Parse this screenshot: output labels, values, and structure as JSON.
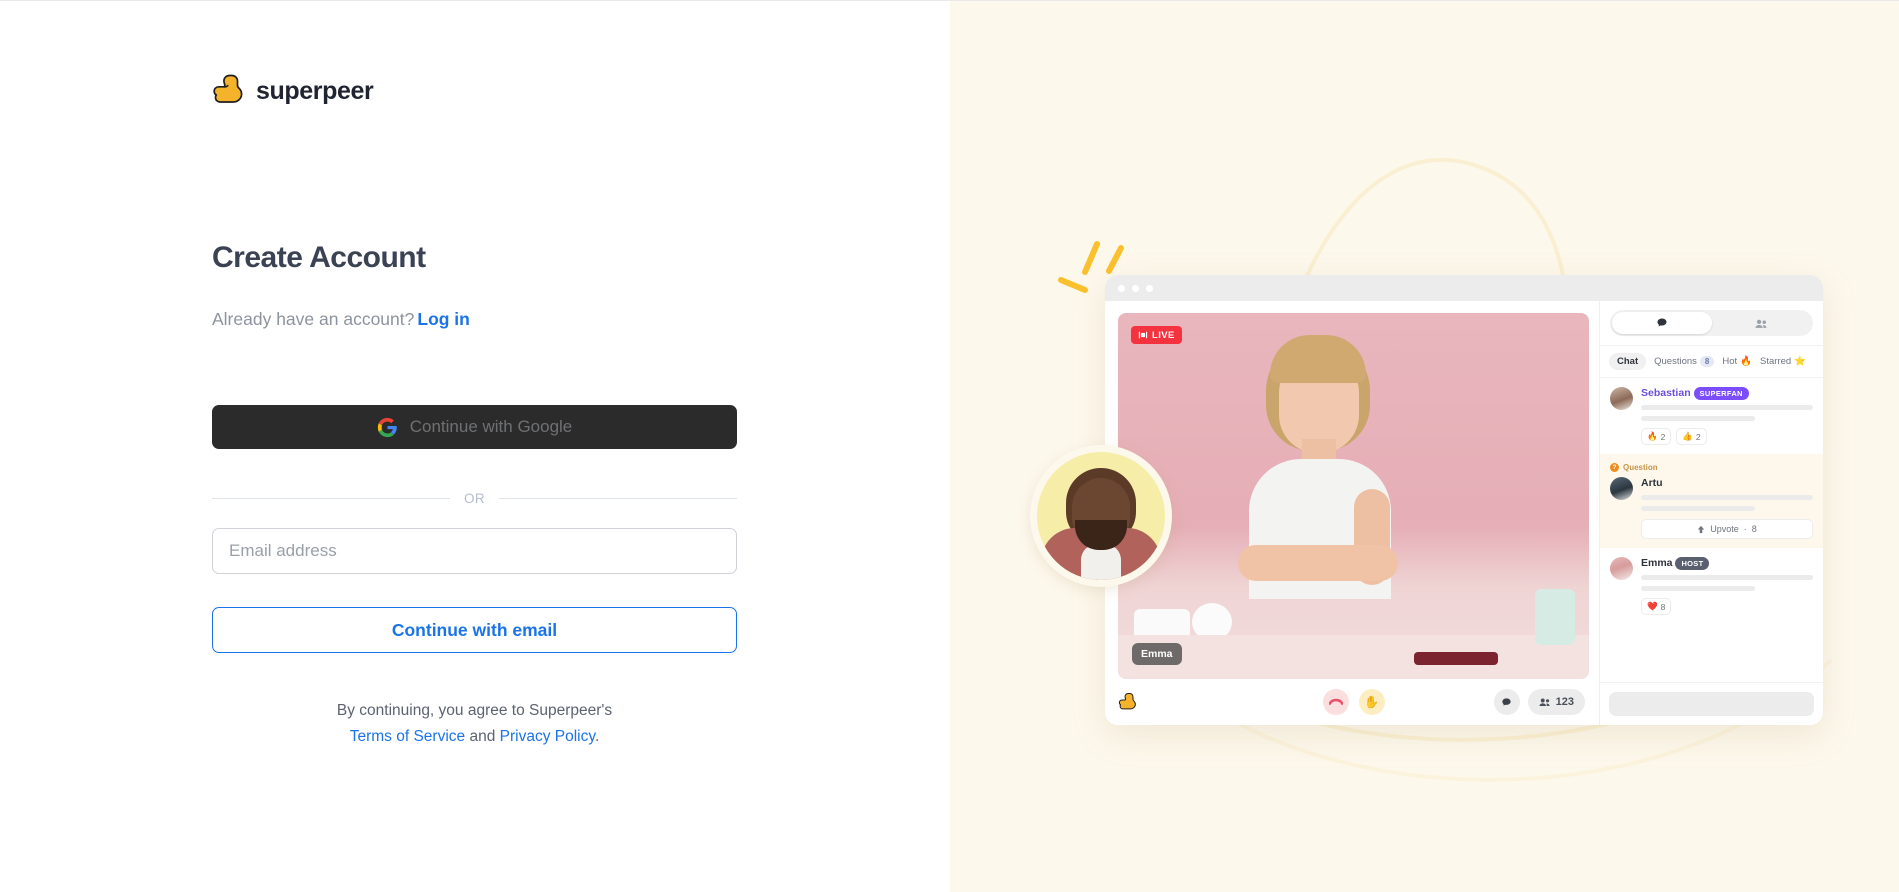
{
  "brand": {
    "name": "superpeer",
    "logo_icon": "thumbs-up-logo",
    "logo_color": "#F5B32B"
  },
  "auth": {
    "headline": "Create Account",
    "existing_account_text": "Already have an account?",
    "login_link": "Log in",
    "google_button": {
      "label": "Continue with Google",
      "icon": "google-g-icon",
      "bg": "#2B2B2B"
    },
    "divider_label": "OR",
    "email_input": {
      "placeholder": "Email address",
      "value": ""
    },
    "email_button": {
      "label": "Continue with email",
      "accent": "#1A73E8"
    },
    "legal": {
      "line1": "By continuing, you agree to Superpeer's",
      "terms_link": "Terms of Service",
      "and_text": "and",
      "privacy_link": "Privacy Policy",
      "period": "."
    }
  },
  "hero": {
    "background": "#FDF8EC",
    "live_badge": "LIVE",
    "speaker_name": "Emma",
    "toolbar": {
      "logo_icon": "superpeer-mark-icon",
      "hangup_icon": "hangup-icon",
      "raise_hand_icon": "raise-hand-icon",
      "chat_icon": "chat-bubble-icon",
      "participants_icon": "people-icon",
      "participants_count": "123"
    },
    "chat_panel": {
      "toggle": {
        "chat_icon": "chat-bubble-icon",
        "people_icon": "people-icon"
      },
      "tabs": [
        {
          "label": "Chat",
          "active": true
        },
        {
          "label": "Questions",
          "badge": "8",
          "active": false
        },
        {
          "label": "Hot",
          "emoji": "🔥",
          "active": false
        },
        {
          "label": "Starred",
          "emoji": "⭐",
          "active": false
        }
      ],
      "messages": [
        {
          "name": "Sebastian",
          "badge": "SUPERFAN",
          "badge_type": "superfan",
          "reactions": [
            {
              "emoji": "🔥",
              "count": "2"
            },
            {
              "emoji": "👍",
              "count": "2"
            }
          ]
        },
        {
          "name": "Artu",
          "question_label": "Question",
          "upvote_label": "Upvote",
          "upvote_separator": "·",
          "upvote_count": "8"
        },
        {
          "name": "Emma",
          "badge": "HOST",
          "badge_type": "host",
          "reactions": [
            {
              "emoji": "❤️",
              "count": "8"
            }
          ]
        }
      ]
    }
  }
}
